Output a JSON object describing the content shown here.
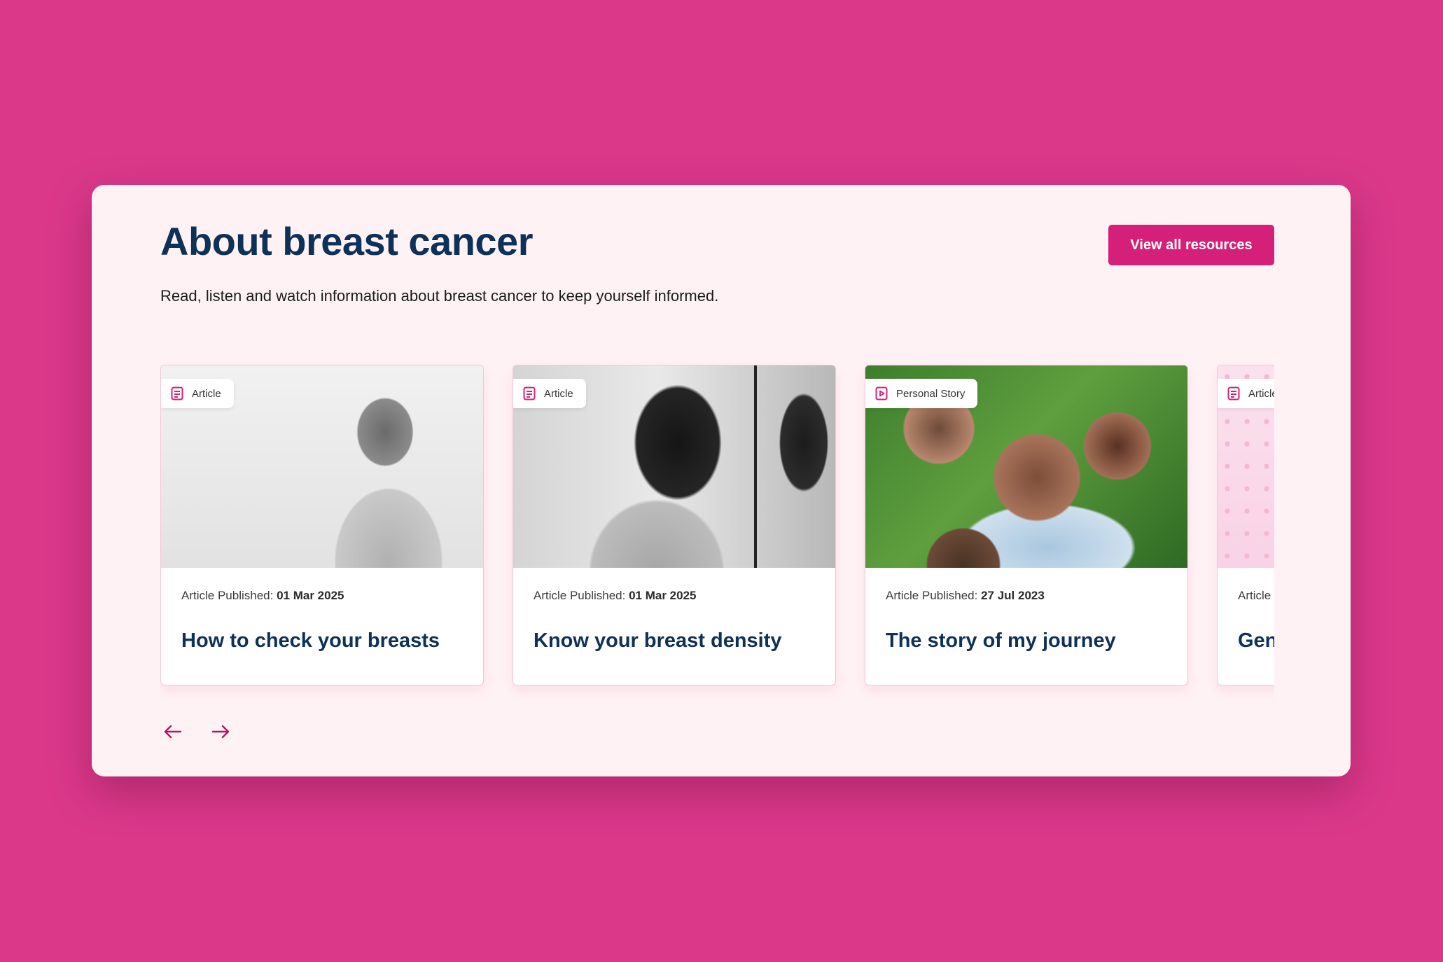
{
  "section": {
    "title": "About breast cancer",
    "subtitle": "Read, listen and watch information about breast cancer to keep yourself informed.",
    "view_all_label": "View all resources"
  },
  "cards": [
    {
      "type_label": "Article",
      "type_icon": "document-icon",
      "published_label": "Article Published:",
      "published_date": "01 Mar 2025",
      "title": "How to check your breasts",
      "image": "Black and white photo of a woman with short curly hair covering her chest"
    },
    {
      "type_label": "Article",
      "type_icon": "document-icon",
      "published_label": "Article Published:",
      "published_date": "01 Mar 2025",
      "title": "Know your breast density",
      "image": "Black and white photo of a woman looking down beside a mirror"
    },
    {
      "type_label": "Personal Story",
      "type_icon": "play-icon",
      "published_label": "Article Published:",
      "published_date": "27 Jul 2023",
      "title": "The story of my journey",
      "image": "Smiling family of four taking a selfie on grass"
    },
    {
      "type_label": "Article",
      "type_icon": "document-icon",
      "published_label": "Article",
      "published_date": "",
      "title": "Gen... can...",
      "image": "Pink patterned graphic"
    }
  ],
  "navigation": {
    "prev_icon": "arrow-left-icon",
    "next_icon": "arrow-right-icon"
  },
  "colors": {
    "background": "#db388a",
    "panel": "#fff2f5",
    "accent": "#d5207a",
    "heading": "#0e3158"
  }
}
